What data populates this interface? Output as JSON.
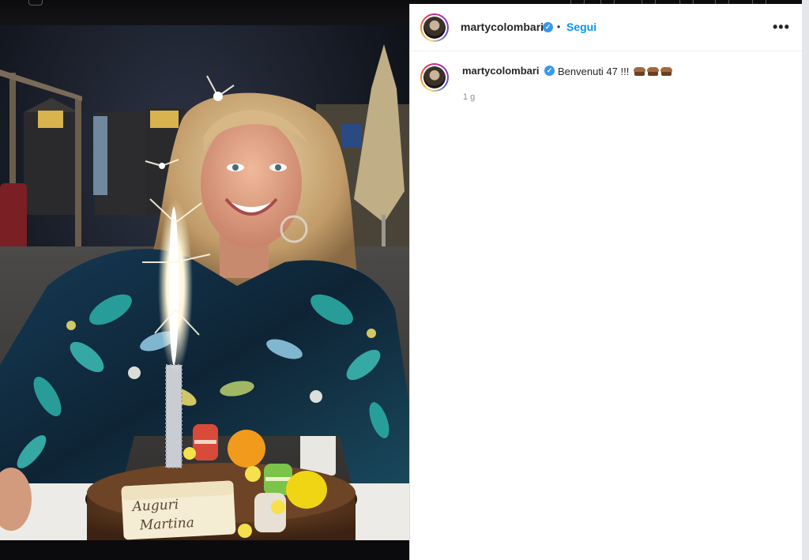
{
  "post": {
    "author": {
      "username": "martycolombari",
      "verified_mark": "✓"
    },
    "header": {
      "separator": "•",
      "follow_label": "Segui",
      "more_label": "•••"
    },
    "caption": {
      "username": "martycolombari",
      "text": "Benvenuti 47 !!!",
      "emojis": [
        "cake-emoji",
        "cake-emoji",
        "cake-emoji"
      ],
      "time_ago": "1 g"
    },
    "photo": {
      "cake_text_line1": "Auguri",
      "cake_text_line2": "Martina"
    }
  },
  "colors": {
    "follow_blue": "#0095f6",
    "verified_blue": "#3897f0",
    "text_primary": "#262626",
    "text_secondary": "#8e8e8e"
  }
}
